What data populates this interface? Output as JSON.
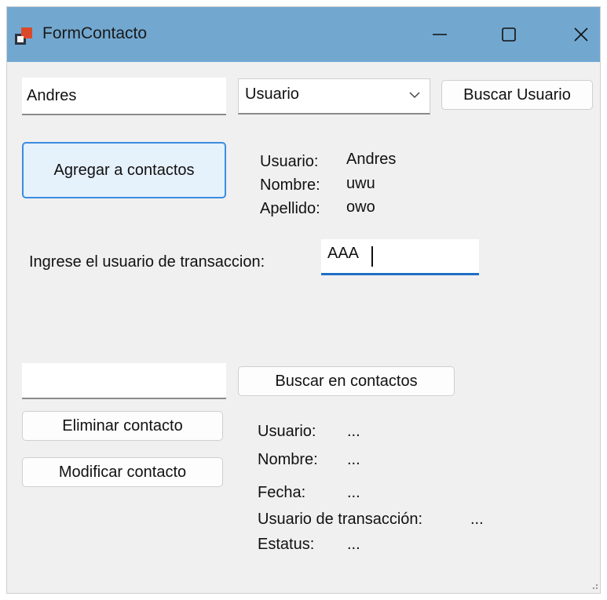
{
  "window": {
    "title": "FormContacto",
    "controls": {
      "minimize": "minimize-icon",
      "maximize": "maximize-icon",
      "close": "close-icon"
    }
  },
  "search_user": {
    "input_value": "Andres",
    "type_select_value": "Usuario",
    "button_label": "Buscar Usuario"
  },
  "add_contact": {
    "button_label": "Agregar a contactos",
    "usuario_label": "Usuario:",
    "usuario_value": "Andres",
    "nombre_label": "Nombre:",
    "nombre_value": "uwu",
    "apellido_label": "Apellido:",
    "apellido_value": "owo"
  },
  "transaction": {
    "label": "Ingrese el usuario de transaccion:",
    "input_value": "AAA"
  },
  "contacts": {
    "search_input_value": "",
    "search_button_label": "Buscar en contactos",
    "delete_button_label": "Eliminar contacto",
    "modify_button_label": "Modificar contacto",
    "details": {
      "usuario_label": "Usuario:",
      "usuario_value": "...",
      "nombre_label": "Nombre:",
      "nombre_value": "...",
      "fecha_label": "Fecha:",
      "fecha_value": "...",
      "transaccion_label": "Usuario de transacción:",
      "transaccion_value": "...",
      "estatus_label": "Estatus:",
      "estatus_value": "..."
    }
  },
  "colors": {
    "titlebar": "#72a8d0",
    "window_bg": "#f0f0f0",
    "accent_focus": "#1f6fc5",
    "primary_button_bg": "#e5f1fb",
    "primary_button_border": "#3c8ce0"
  }
}
